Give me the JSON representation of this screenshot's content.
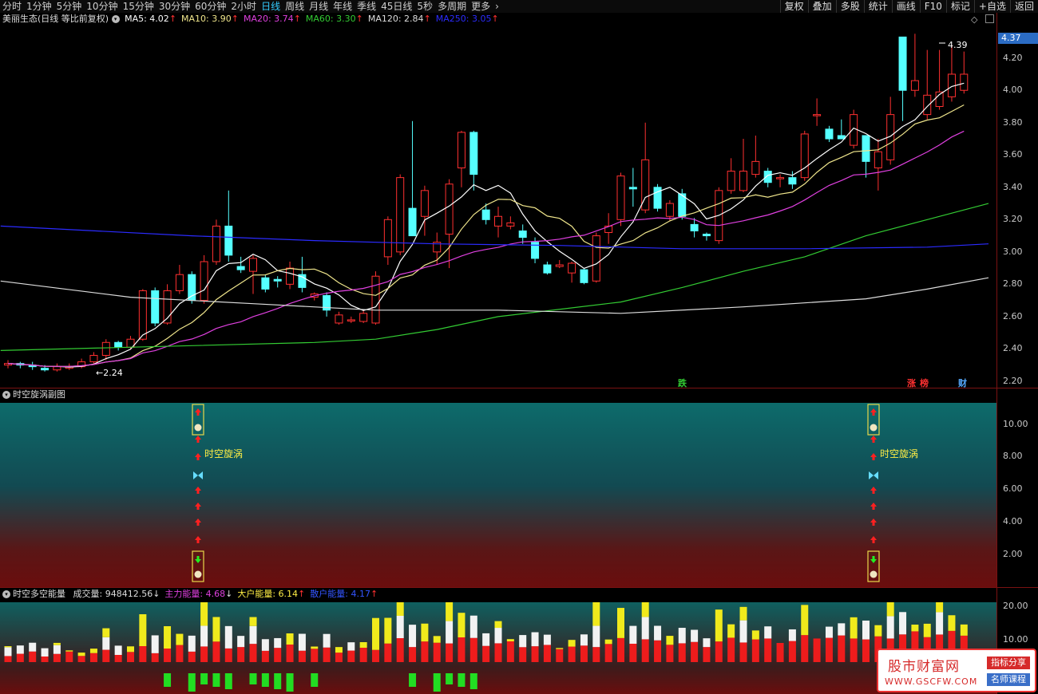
{
  "toolbar": {
    "periods": [
      "分时",
      "1分钟",
      "5分钟",
      "10分钟",
      "15分钟",
      "30分钟",
      "60分钟",
      "2小时",
      "日线",
      "周线",
      "月线",
      "年线",
      "季线",
      "45日线",
      "5秒",
      "多周期",
      "更多"
    ],
    "active_period": "日线",
    "right_buttons": [
      "复权",
      "叠加",
      "多股",
      "统计",
      "画线",
      "F10",
      "标记",
      "+自选",
      "返回"
    ]
  },
  "main_header": {
    "stock_title": "美丽生态(日线 等比前复权)",
    "ma": [
      {
        "label": "MA5: 4.02",
        "arrow": "↑",
        "color": "#ffffff"
      },
      {
        "label": "MA10: 3.90",
        "arrow": "↑",
        "color": "#f0e68c"
      },
      {
        "label": "MA20: 3.74",
        "arrow": "↑",
        "color": "#e040e0"
      },
      {
        "label": "MA60: 3.30",
        "arrow": "↑",
        "color": "#33cc33"
      },
      {
        "label": "MA120: 2.84",
        "arrow": "↑",
        "color": "#dddddd"
      },
      {
        "label": "MA250: 3.05",
        "arrow": "↑",
        "color": "#2b2bff"
      }
    ]
  },
  "current_price": "4.37",
  "y_axis_main": [
    "4.20",
    "4.00",
    "3.80",
    "3.60",
    "3.40",
    "3.20",
    "3.00",
    "2.80",
    "2.60",
    "2.40",
    "2.20"
  ],
  "y_axis_main_values": [
    4.2,
    4.0,
    3.8,
    3.6,
    3.4,
    3.2,
    3.0,
    2.8,
    2.6,
    2.4,
    2.2
  ],
  "high_label": "4.39",
  "low_label": "2.24",
  "signal_labels": {
    "die": "跌",
    "zhang": "涨",
    "bang": "榜",
    "cai": "财"
  },
  "sub1": {
    "title": "时空旋涡副图",
    "y_axis": [
      "10.00",
      "8.00",
      "6.00",
      "4.00",
      "2.00"
    ],
    "label": "时空旋涡"
  },
  "sub2": {
    "title": "时空多空能量",
    "fields": [
      {
        "label": "成交量: 948412.56",
        "arrow": "↓",
        "color": "#dddddd"
      },
      {
        "label": "主力能量: 4.68",
        "arrow": "↓",
        "color": "#e040e0"
      },
      {
        "label": "大户能量: 6.14",
        "arrow": "↑",
        "color": "#ffee44"
      },
      {
        "label": "散户能量: 4.17",
        "arrow": "↑",
        "color": "#3355ff"
      }
    ],
    "y_axis": [
      "20.00",
      "10.00"
    ]
  },
  "watermark": {
    "title": "股市财富网",
    "url": "WWW.GSCFW.COM",
    "tag1": "指标分享",
    "tag2": "名师课程"
  },
  "colors": {
    "up": "#ff3030",
    "down": "#55ffff",
    "ma5": "#ffffff",
    "ma10": "#f0e68c",
    "ma20": "#e040e0",
    "ma60": "#33cc33",
    "ma120": "#dddddd",
    "ma250": "#2b2bff"
  },
  "chart_data": {
    "type": "candlestick",
    "y_range": [
      2.16,
      4.48
    ],
    "candles": [
      [
        2.3,
        2.31,
        2.33,
        2.28
      ],
      [
        2.31,
        2.3,
        2.32,
        2.28
      ],
      [
        2.3,
        2.29,
        2.32,
        2.27
      ],
      [
        2.28,
        2.27,
        2.3,
        2.26
      ],
      [
        2.27,
        2.29,
        2.31,
        2.26
      ],
      [
        2.28,
        2.29,
        2.31,
        2.27
      ],
      [
        2.29,
        2.32,
        2.34,
        2.28
      ],
      [
        2.32,
        2.36,
        2.38,
        2.31
      ],
      [
        2.36,
        2.44,
        2.46,
        2.33
      ],
      [
        2.44,
        2.41,
        2.45,
        2.39
      ],
      [
        2.41,
        2.46,
        2.48,
        2.4
      ],
      [
        2.46,
        2.76,
        2.77,
        2.45
      ],
      [
        2.76,
        2.56,
        2.78,
        2.54
      ],
      [
        2.56,
        2.76,
        2.8,
        2.55
      ],
      [
        2.76,
        2.86,
        2.92,
        2.74
      ],
      [
        2.86,
        2.7,
        2.88,
        2.68
      ],
      [
        2.7,
        2.94,
        2.98,
        2.68
      ],
      [
        2.94,
        3.16,
        3.2,
        2.92
      ],
      [
        3.16,
        2.98,
        3.38,
        2.94
      ],
      [
        2.91,
        2.89,
        2.97,
        2.87
      ],
      [
        2.88,
        2.96,
        2.98,
        2.74
      ],
      [
        2.84,
        2.77,
        2.86,
        2.75
      ],
      [
        2.83,
        2.82,
        2.85,
        2.78
      ],
      [
        2.8,
        2.9,
        2.94,
        2.77
      ],
      [
        2.86,
        2.78,
        2.97,
        2.75
      ],
      [
        2.72,
        2.74,
        2.75,
        2.7
      ],
      [
        2.73,
        2.64,
        2.75,
        2.6
      ],
      [
        2.56,
        2.61,
        2.63,
        2.55
      ],
      [
        2.58,
        2.58,
        2.6,
        2.56
      ],
      [
        2.57,
        2.62,
        2.64,
        2.56
      ],
      [
        2.56,
        2.85,
        2.88,
        2.55
      ],
      [
        2.97,
        3.2,
        3.22,
        2.92
      ],
      [
        3.0,
        3.46,
        3.48,
        2.98
      ],
      [
        3.27,
        3.1,
        3.81,
        3.1
      ],
      [
        3.22,
        3.38,
        3.41,
        3.1
      ],
      [
        3.0,
        3.06,
        3.12,
        2.92
      ],
      [
        3.11,
        3.42,
        3.45,
        2.9
      ],
      [
        3.52,
        3.74,
        3.75,
        3.4
      ],
      [
        3.74,
        3.48,
        3.75,
        3.38
      ],
      [
        3.26,
        3.2,
        3.3,
        3.17
      ],
      [
        3.16,
        3.22,
        3.28,
        3.09
      ],
      [
        3.16,
        3.18,
        3.22,
        3.14
      ],
      [
        3.13,
        3.09,
        3.17,
        3.05
      ],
      [
        3.06,
        2.96,
        3.09,
        2.93
      ],
      [
        2.92,
        2.87,
        2.94,
        2.86
      ],
      [
        2.91,
        2.92,
        2.95,
        2.9
      ],
      [
        2.87,
        2.93,
        2.94,
        2.81
      ],
      [
        2.89,
        2.81,
        2.9,
        2.8
      ],
      [
        2.82,
        3.1,
        3.12,
        2.81
      ],
      [
        3.12,
        3.16,
        3.24,
        3.05
      ],
      [
        3.2,
        3.47,
        3.49,
        3.16
      ],
      [
        3.4,
        3.39,
        3.52,
        3.28
      ],
      [
        3.26,
        3.57,
        3.8,
        3.24
      ],
      [
        3.4,
        3.27,
        3.42,
        3.25
      ],
      [
        3.22,
        3.3,
        3.32,
        3.19
      ],
      [
        3.36,
        3.22,
        3.39,
        3.2
      ],
      [
        3.17,
        3.13,
        3.21,
        3.09
      ],
      [
        3.11,
        3.1,
        3.12,
        3.07
      ],
      [
        3.07,
        3.38,
        3.4,
        3.05
      ],
      [
        3.38,
        3.5,
        3.58,
        3.36
      ],
      [
        3.38,
        3.5,
        3.7,
        3.37
      ],
      [
        3.48,
        3.56,
        3.72,
        3.46
      ],
      [
        3.5,
        3.43,
        3.52,
        3.4
      ],
      [
        3.46,
        3.46,
        3.48,
        3.4
      ],
      [
        3.46,
        3.42,
        3.5,
        3.39
      ],
      [
        3.46,
        3.73,
        3.75,
        3.44
      ],
      [
        3.85,
        3.85,
        3.95,
        3.78
      ],
      [
        3.76,
        3.7,
        3.78,
        3.68
      ],
      [
        3.72,
        3.7,
        3.82,
        3.7
      ],
      [
        3.66,
        3.85,
        3.88,
        3.64
      ],
      [
        3.72,
        3.56,
        3.72,
        3.46
      ],
      [
        3.52,
        3.62,
        3.7,
        3.38
      ],
      [
        3.57,
        3.85,
        3.96,
        3.54
      ],
      [
        4.33,
        4.0,
        4.33,
        3.81
      ],
      [
        4.0,
        4.06,
        4.35,
        3.96
      ],
      [
        3.85,
        3.97,
        4.25,
        3.82
      ],
      [
        3.9,
        3.99,
        4.25,
        3.88
      ],
      [
        3.96,
        4.1,
        4.28,
        3.93
      ],
      [
        4.0,
        4.1,
        4.24,
        3.98
      ]
    ]
  }
}
